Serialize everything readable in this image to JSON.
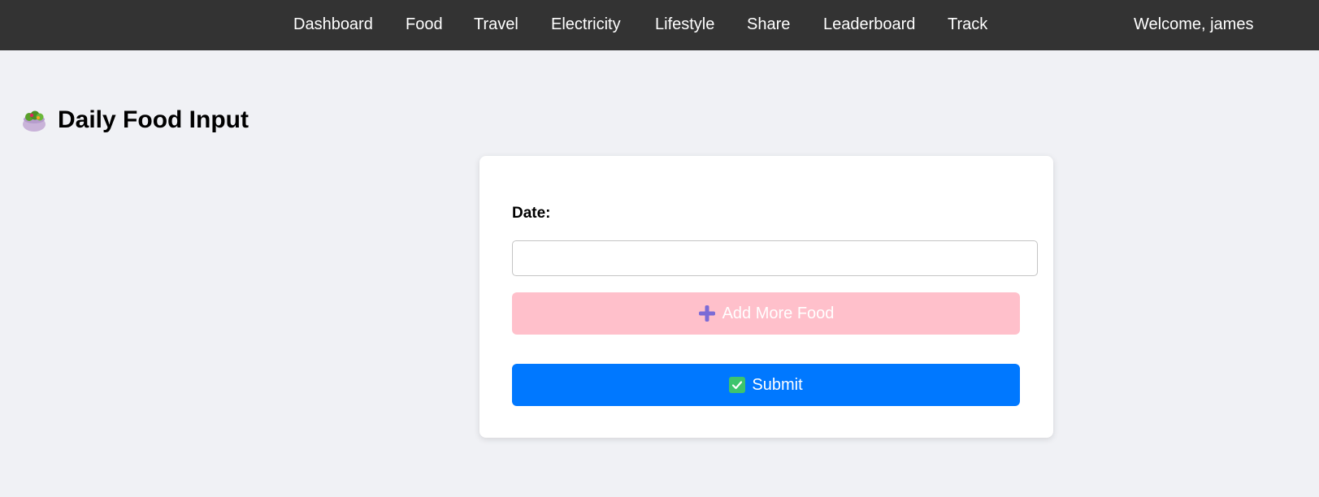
{
  "nav": {
    "items": [
      {
        "label": "Dashboard"
      },
      {
        "label": "Food"
      },
      {
        "label": "Travel"
      },
      {
        "label": "Electricity"
      },
      {
        "label": "Lifestyle"
      },
      {
        "label": "Share"
      },
      {
        "label": "Leaderboard"
      },
      {
        "label": "Track"
      }
    ],
    "welcome": "Welcome, james"
  },
  "page": {
    "title": "Daily Food Input",
    "title_icon": "salad-bowl-icon"
  },
  "form": {
    "date_label": "Date:",
    "date_value": "",
    "food_input": {
      "value": "",
      "placeholder": ""
    },
    "add_more_label": "Add More Food",
    "add_more_icon": "plus-icon",
    "submit_label": "Submit",
    "submit_icon": "check-icon"
  },
  "colors": {
    "navbar": "#333333",
    "background": "#f0f1f5",
    "add_button": "#ffc0cb",
    "submit_button": "#0078ff"
  }
}
